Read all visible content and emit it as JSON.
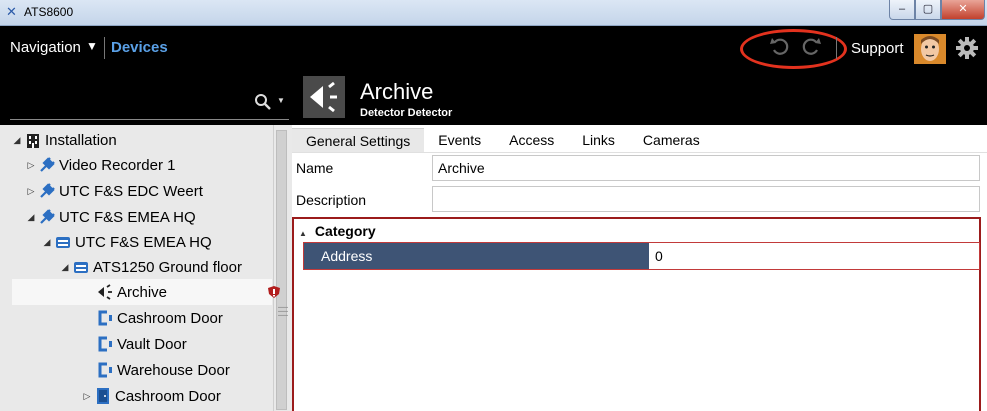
{
  "window": {
    "title": "ATS8600",
    "min": "‒",
    "max": "▢",
    "close": "✕"
  },
  "topbar": {
    "navigation_label": "Navigation",
    "devices_label": "Devices",
    "support_label": "Support"
  },
  "tree": {
    "items": [
      {
        "label": "Installation",
        "expander": "◢",
        "icon": "building-icon"
      },
      {
        "label": "Video Recorder 1",
        "expander": "▷",
        "icon": "plug-icon"
      },
      {
        "label": "UTC F&S EDC Weert",
        "expander": "▷",
        "icon": "plug-icon"
      },
      {
        "label": "UTC F&S EMEA HQ",
        "expander": "◢",
        "icon": "plug-icon"
      },
      {
        "label": "UTC F&S EMEA HQ",
        "expander": "◢",
        "icon": "panel-icon"
      },
      {
        "label": "ATS1250 Ground floor",
        "expander": "◢",
        "icon": "panel-icon"
      },
      {
        "label": "Archive",
        "expander": "",
        "icon": "detector-icon"
      },
      {
        "label": "Cashroom Door",
        "expander": "",
        "icon": "door-contact-icon"
      },
      {
        "label": "Vault Door",
        "expander": "",
        "icon": "door-contact-icon"
      },
      {
        "label": "Warehouse Door",
        "expander": "",
        "icon": "door-contact-icon"
      },
      {
        "label": "Cashroom Door",
        "expander": "▷",
        "icon": "door-icon"
      }
    ]
  },
  "detail": {
    "title": "Archive",
    "subtitle": "Detector Detector",
    "tabs": [
      "General Settings",
      "Events",
      "Access",
      "Links",
      "Cameras"
    ],
    "name_label": "Name",
    "name_value": "Archive",
    "description_label": "Description",
    "description_value": "",
    "category_label": "Category",
    "address_label": "Address",
    "address_value": "0"
  },
  "colors": {
    "accent": "#5aa0e6",
    "highlight_ring": "#e3321e",
    "address_row": "#3e5475",
    "category_border": "#9b1b1b"
  }
}
